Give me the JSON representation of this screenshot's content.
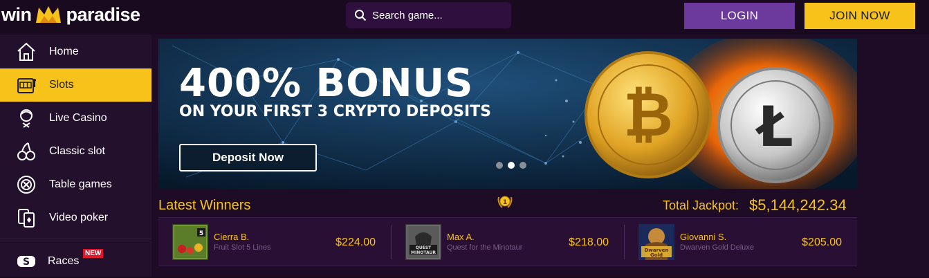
{
  "header": {
    "logo_left": "win",
    "logo_right": "paradise",
    "search_placeholder": "Search game...",
    "login_label": "LOGIN",
    "join_label": "JOIN NOW"
  },
  "sidebar": {
    "items": [
      {
        "label": "Home",
        "icon": "house-icon"
      },
      {
        "label": "Slots",
        "icon": "slot-machine-icon",
        "active": true
      },
      {
        "label": "Live Casino",
        "icon": "dealer-icon"
      },
      {
        "label": "Classic slot",
        "icon": "cherries-icon"
      },
      {
        "label": "Table games",
        "icon": "casino-chip-icon"
      },
      {
        "label": "Video poker",
        "icon": "playing-cards-icon"
      },
      {
        "label": "Races",
        "icon": "races-icon",
        "badge": "NEW"
      }
    ]
  },
  "banner": {
    "title": "400% BONUS",
    "subtitle": "ON YOUR FIRST 3 CRYPTO DEPOSITS",
    "cta": "Deposit Now",
    "slides": 3,
    "active_slide": 2
  },
  "winners": {
    "title": "Latest Winners",
    "jackpot_label": "Total Jackpot:",
    "jackpot_value": "$5,144,242.34",
    "entries": [
      {
        "name": "Cierra B.",
        "game": "Fruit Slot 5 Lines",
        "amount": "$224.00"
      },
      {
        "name": "Max A.",
        "game": "Quest for the Minotaur",
        "amount": "$218.00"
      },
      {
        "name": "Giovanni S.",
        "game": "Dwarven Gold Deluxe",
        "amount": "$205.00"
      }
    ]
  },
  "colors": {
    "accent": "#f7c31b",
    "login": "#6b3a9c",
    "background": "#1a0a1f"
  }
}
